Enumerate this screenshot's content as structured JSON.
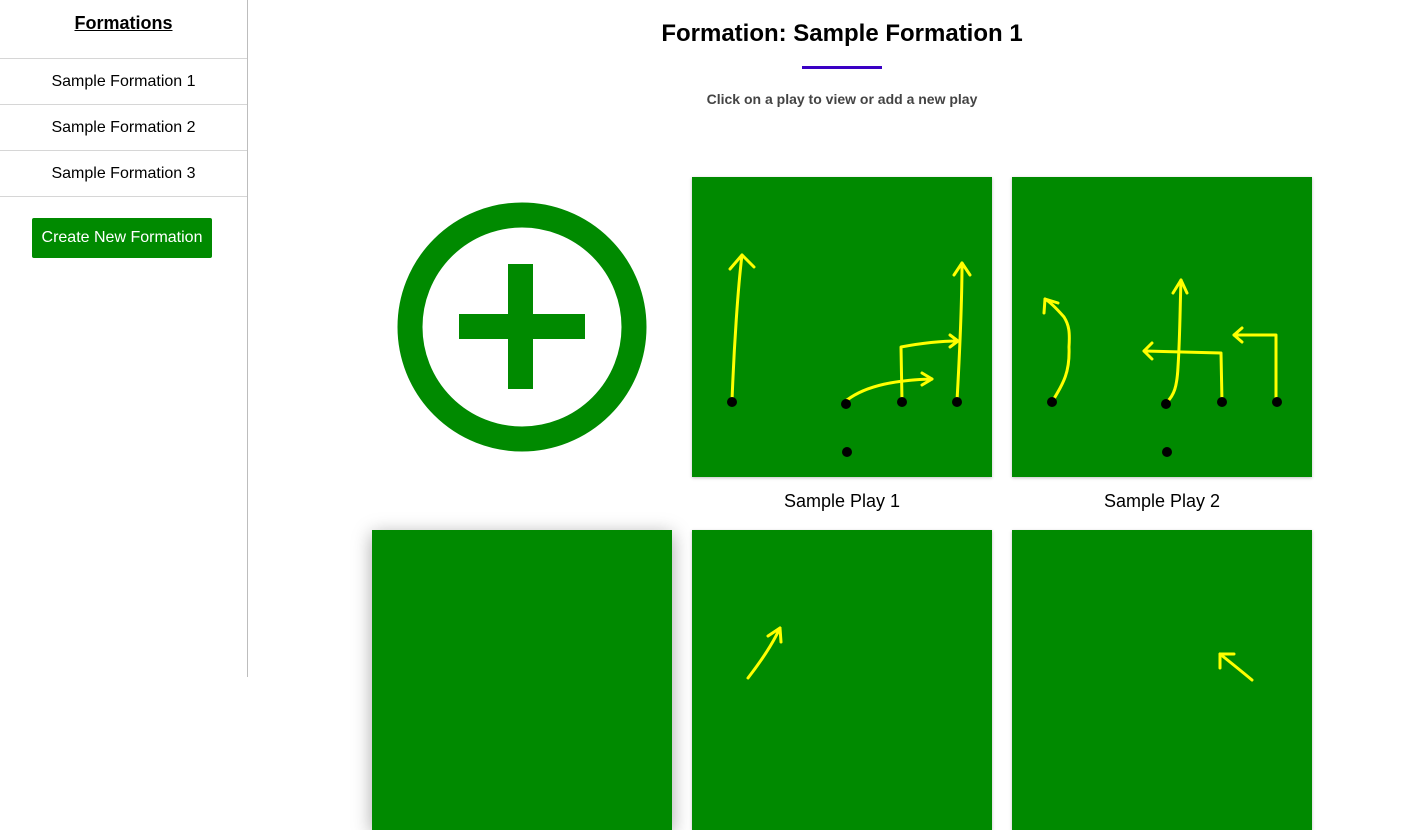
{
  "sidebar": {
    "title": "Formations",
    "items": [
      {
        "label": "Sample Formation 1"
      },
      {
        "label": "Sample Formation 2"
      },
      {
        "label": "Sample Formation 3"
      }
    ],
    "create_button": "Create New Formation"
  },
  "main": {
    "title": "Formation: Sample Formation 1",
    "subtitle": "Click on a play to view or add a new play",
    "add_icon": "plus-circle-icon",
    "plays": [
      {
        "label": "Sample Play 1"
      },
      {
        "label": "Sample Play 2"
      }
    ]
  },
  "colors": {
    "field": "#008a00",
    "route": "#ffff00",
    "accent": "#3a00c4",
    "button": "#008a00"
  }
}
